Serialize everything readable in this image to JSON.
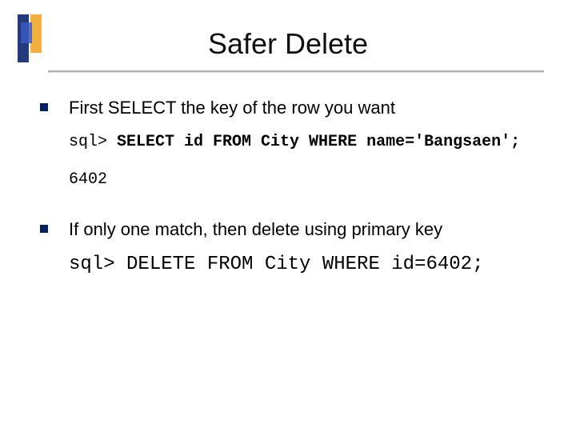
{
  "title": "Safer Delete",
  "bullets": [
    {
      "text": "First SELECT the key of the row you want",
      "code_prompt": "sql>",
      "code_stmt": " SELECT id FROM City WHERE name='Bangsaen';",
      "result": "6402"
    },
    {
      "text": "If only one match, then delete using primary key",
      "code_prompt": "sql>",
      "code_stmt_big": " DELETE FROM City WHERE id=6402;"
    }
  ]
}
